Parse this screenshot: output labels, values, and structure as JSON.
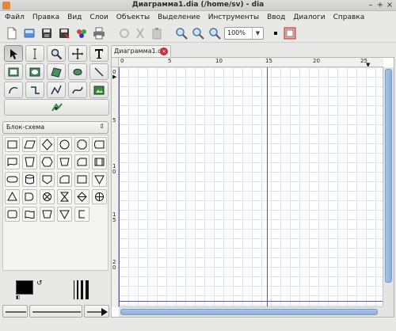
{
  "window": {
    "title": "Диаграмма1.dia (/home/sv) - dia",
    "controls": [
      "–",
      "+",
      "×"
    ]
  },
  "menu": [
    "Файл",
    "Правка",
    "Вид",
    "Слои",
    "Объекты",
    "Выделение",
    "Инструменты",
    "Ввод",
    "Диалоги",
    "Справка"
  ],
  "toolbar": {
    "icons": [
      "new-file-icon",
      "open-file-icon",
      "save-icon",
      "save-as-icon",
      "export-icon",
      "print-icon",
      "undo-icon",
      "cut-icon",
      "paste-icon",
      "zoom-in-icon",
      "zoom-out-icon",
      "zoom-fit-icon"
    ],
    "zoom_value": "100%"
  },
  "tools": [
    {
      "name": "select-tool",
      "glyph": "↖",
      "active": true
    },
    {
      "name": "text-edit-tool",
      "glyph": "I"
    },
    {
      "name": "magnify-tool",
      "glyph": "🔍"
    },
    {
      "name": "move-tool",
      "glyph": "✥"
    },
    {
      "name": "text-tool",
      "glyph": "T"
    },
    {
      "name": "box-tool",
      "glyph": "▣"
    },
    {
      "name": "ellipse-tool",
      "glyph": "◉"
    },
    {
      "name": "polygon-tool",
      "glyph": "⬠"
    },
    {
      "name": "beziergon-tool",
      "glyph": "⬭"
    },
    {
      "name": "line-tool",
      "glyph": "╲"
    },
    {
      "name": "arc-tool",
      "glyph": "↷"
    },
    {
      "name": "zigzag-tool",
      "glyph": "⌐"
    },
    {
      "name": "polyline-tool",
      "glyph": "⟋"
    },
    {
      "name": "bezier-tool",
      "glyph": "∿"
    },
    {
      "name": "image-tool",
      "glyph": "▦"
    }
  ],
  "sheet": {
    "selected": "Блок-схема"
  },
  "shapes": [
    "box",
    "parallelogram",
    "diamond",
    "ellipse",
    "octagon",
    "manual-input",
    "document",
    "pentagon",
    "hexagon",
    "trapezoid",
    "card",
    "predefined-process",
    "terminator",
    "cylinder",
    "offpage",
    "delay",
    "punched-card",
    "triangle-down",
    "triangle-up",
    "delay-d",
    "sum-junction",
    "hourglass",
    "sort",
    "or-junction",
    "process",
    "flag-tape",
    "extract-trapezoid",
    "merge",
    "bracket"
  ],
  "tab": {
    "label": "Диаграмма1.dia"
  },
  "rulers": {
    "h_labels": [
      "0",
      "5",
      "10",
      "15",
      "20",
      "25"
    ],
    "v_labels": [
      "0",
      "5",
      "1 0",
      "1 5",
      "2 0"
    ]
  },
  "colors": {
    "foreground": "#000000",
    "background": "#ffffff",
    "page_border": "#5a5aa5",
    "scrollbar": "#8eafd8"
  }
}
